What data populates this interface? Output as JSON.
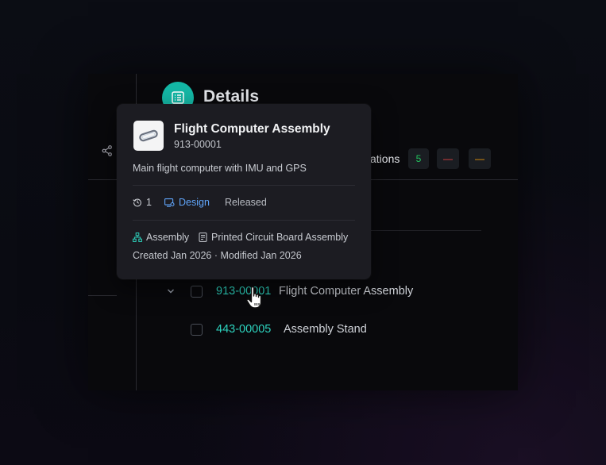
{
  "details": {
    "title": "Details"
  },
  "tab": {
    "label": "ations",
    "counts": [
      "5",
      "—",
      "—"
    ]
  },
  "tree": {
    "rows": [
      {
        "part_number": "913-00001",
        "name": "Flight Computer Assembly"
      },
      {
        "part_number": "443-00005",
        "name": "Assembly Stand"
      }
    ]
  },
  "card": {
    "title": "Flight Computer Assembly",
    "code": "913-00001",
    "description": "Main flight computer with IMU and GPS",
    "revision": "1",
    "stage": "Design",
    "status": "Released",
    "type": "Assembly",
    "category": "Printed Circuit Board Assembly",
    "dates": "Created Jan 2026 · Modified Jan 2026"
  },
  "colors": {
    "accent": "#14b8a6",
    "part_number": "#2dd4bf",
    "stage": "#60a5fa",
    "count_green": "#22c55e",
    "count_red": "#ef4444",
    "count_orange": "#f59e0b"
  },
  "icons": [
    "share-icon",
    "list-icon",
    "chevron-down-icon",
    "link-icon",
    "history-icon",
    "design-icon",
    "hierarchy-icon",
    "document-icon",
    "hand-cursor-icon"
  ]
}
